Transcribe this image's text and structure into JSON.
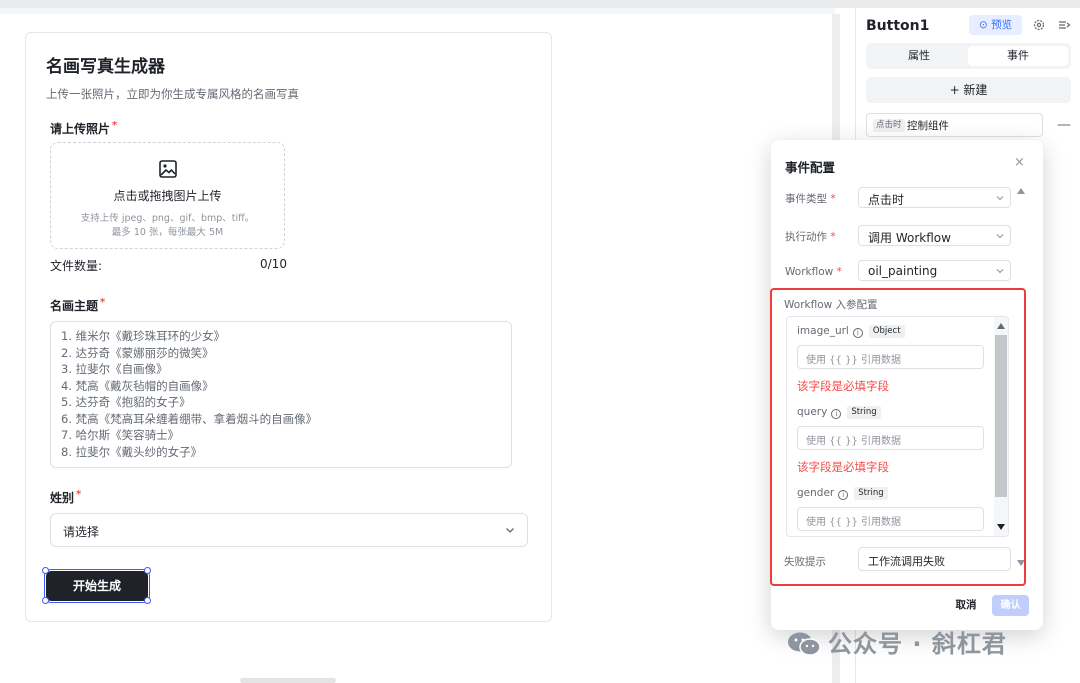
{
  "form": {
    "title": "名画写真生成器",
    "description": "上传一张照片，立即为你生成专属风格的名画写真",
    "upload_label": "请上传照片",
    "upload_main": "点击或拖拽图片上传",
    "upload_sub1": "支持上传 jpeg、png、gif、bmp、tiff。",
    "upload_sub2": "最多 10 张，每张最大 5M",
    "file_count_label": "文件数量:",
    "file_count_value": "0/10",
    "theme_label": "名画主题",
    "theme_lines": [
      "1. 维米尔《戴珍珠耳环的少女》",
      "2. 达芬奇《蒙娜丽莎的微笑》",
      "3. 拉斐尔《自画像》",
      "4. 梵高《戴灰毡帽的自画像》",
      "5. 达芬奇《抱貂的女子》",
      "6. 梵高《梵高耳朵缠着绷带、拿着烟斗的自画像》",
      "7. 哈尔斯《笑容骑士》",
      "8. 拉斐尔《戴头纱的女子》"
    ],
    "gender_label": "姓别",
    "gender_placeholder": "请选择",
    "generate_button": "开始生成",
    "required_mark": "*"
  },
  "properties_panel": {
    "component_name": "Button1",
    "preview_label": "预览",
    "tabs": [
      {
        "label": "属性",
        "active": false
      },
      {
        "label": "事件",
        "active": true
      }
    ],
    "new_label": "+ 新建",
    "event_tag": "点击时",
    "event_text": "控制组件",
    "remove_label": "—"
  },
  "event_modal": {
    "title": "事件配置",
    "close": "×",
    "event_type_label": "事件类型",
    "event_type_value": "点击时",
    "action_label": "执行动作",
    "action_value": "调用 Workflow",
    "workflow_label": "Workflow",
    "workflow_value": "oil_painting",
    "params_header": "Workflow 入参配置",
    "params": [
      {
        "name": "image_url",
        "type": "Object",
        "placeholder": "使用 {{ }} 引用数据",
        "error": "该字段是必填字段"
      },
      {
        "name": "query",
        "type": "String",
        "placeholder": "使用 {{ }} 引用数据",
        "error": "该字段是必填字段"
      },
      {
        "name": "gender",
        "type": "String",
        "placeholder": "使用 {{ }} 引用数据",
        "error": ""
      }
    ],
    "fail_label": "失败提示",
    "fail_value": "工作流调用失败",
    "cancel": "取消",
    "confirm": "确认",
    "required_mark": "*"
  },
  "watermark": {
    "text": "公众号 · 斜杠君"
  },
  "colors": {
    "accent": "#3370ff",
    "required": "#f54a45",
    "highlight_box": "#ea3d3d",
    "button_dark": "#1f2329",
    "confirm_disabled": "#c0cdfd"
  },
  "icons": {
    "upload": "image-icon",
    "preview": "play-circle-icon",
    "settings": "gear-icon",
    "collapse": "collapse-panel-icon",
    "select": "chevron-down-icon",
    "info": "info-icon",
    "close": "close-icon",
    "watermark": "wechat-icon"
  }
}
